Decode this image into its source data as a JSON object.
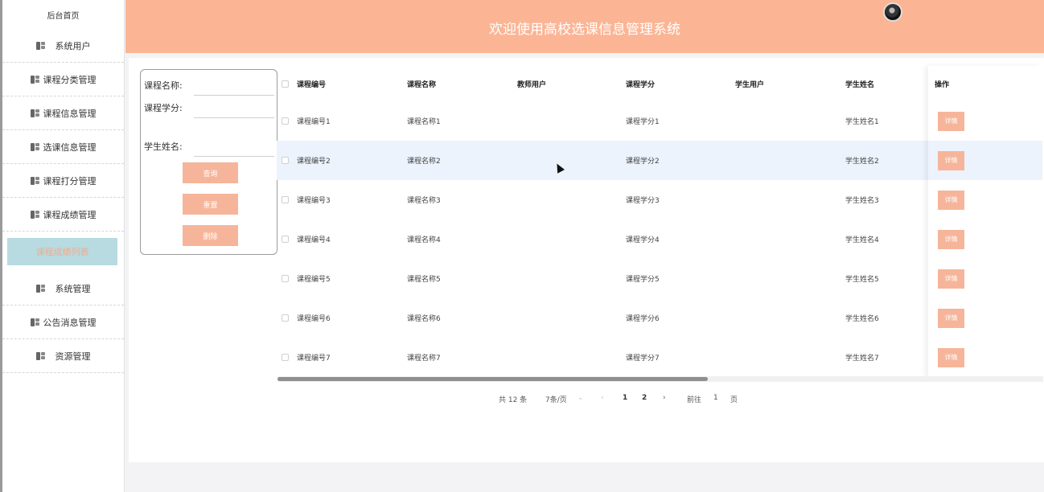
{
  "sidebar": {
    "home": "后台首页",
    "items": [
      {
        "label": "系统用户",
        "wide": true
      },
      {
        "label": "课程分类管理"
      },
      {
        "label": "课程信息管理"
      },
      {
        "label": "选课信息管理"
      },
      {
        "label": "课程打分管理"
      },
      {
        "label": "课程成绩管理"
      },
      {
        "label": "课程成绩列表",
        "active": true
      },
      {
        "label": "系统管理",
        "wide": true
      },
      {
        "label": "公告消息管理"
      },
      {
        "label": "资源管理",
        "wide": true
      }
    ]
  },
  "header": {
    "title": "欢迎使用高校选课信息管理系统"
  },
  "search": {
    "course_name_label": "课程名称:",
    "course_credit_label": "课程学分:",
    "student_name_label": "学生姓名:",
    "query_button": "查询",
    "reset_button": "重置",
    "delete_button": "删除"
  },
  "table": {
    "columns": [
      "课程编号",
      "课程名称",
      "教师用户",
      "课程学分",
      "学生用户",
      "学生姓名",
      "操作"
    ],
    "rows": [
      {
        "course_no": "课程编号1",
        "course_name": "课程名称1",
        "teacher": "",
        "credit": "课程学分1",
        "student_user": "",
        "student_name": "学生姓名1",
        "action": "详情"
      },
      {
        "course_no": "课程编号2",
        "course_name": "课程名称2",
        "teacher": "",
        "credit": "课程学分2",
        "student_user": "",
        "student_name": "学生姓名2",
        "action": "详情"
      },
      {
        "course_no": "课程编号3",
        "course_name": "课程名称3",
        "teacher": "",
        "credit": "课程学分3",
        "student_user": "",
        "student_name": "学生姓名3",
        "action": "详情"
      },
      {
        "course_no": "课程编号4",
        "course_name": "课程名称4",
        "teacher": "",
        "credit": "课程学分4",
        "student_user": "",
        "student_name": "学生姓名4",
        "action": "详情"
      },
      {
        "course_no": "课程编号5",
        "course_name": "课程名称5",
        "teacher": "",
        "credit": "课程学分5",
        "student_user": "",
        "student_name": "学生姓名5",
        "action": "详情"
      },
      {
        "course_no": "课程编号6",
        "course_name": "课程名称6",
        "teacher": "",
        "credit": "课程学分6",
        "student_user": "",
        "student_name": "学生姓名6",
        "action": "详情"
      },
      {
        "course_no": "课程编号7",
        "course_name": "课程名称7",
        "teacher": "",
        "credit": "课程学分7",
        "student_user": "",
        "student_name": "学生姓名7",
        "action": "详情"
      }
    ]
  },
  "pagination": {
    "total": "共 12 条",
    "page_size": "7条/页",
    "pages": [
      "1",
      "2"
    ],
    "current_page": "1",
    "goto_label": "前往",
    "goto_value": "1",
    "page_suffix": "页"
  },
  "colors": {
    "accent": "#fbb595",
    "button": "#f6b59a",
    "active_menu_bg": "#b7dbe0"
  }
}
